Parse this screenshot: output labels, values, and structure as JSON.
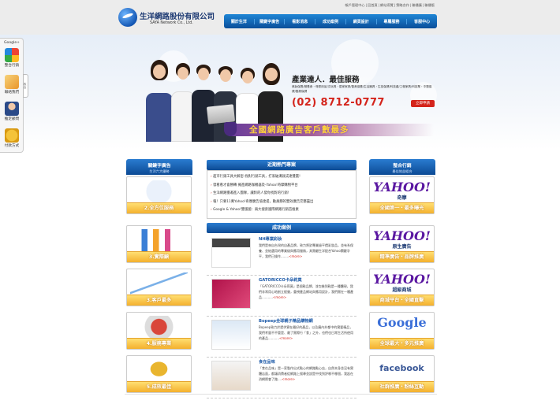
{
  "top_links": [
    "帳戶管理中心",
    "回首頁",
    "網站導覽",
    "策略合作",
    "聯播廣",
    "聯播版"
  ],
  "logo": {
    "cn": "生洋網路股份有限公司",
    "en": "SAYA Network Co., Ltd."
  },
  "nav": [
    "關於生洋",
    "關鍵字廣告",
    "看影消息",
    "成功案例",
    "網頁設計",
    "專屬服務",
    "客服中心"
  ],
  "sidebar": {
    "top": "Google+",
    "items": [
      "整合行銷",
      "聯絡我們",
      "推定顧問",
      "付款方式"
    ],
    "tab": "收合"
  },
  "hero": {
    "title": "產業達人．最佳服務",
    "desc": "美妝保養/營養食・母嬰用品/文玩具・居家家具/醫美保養/生活器具・生技保健/科技產/工程家具/科技業・中醫保健/醫療保健",
    "phone": "(02) 8712-0777",
    "apply": "立即申請",
    "banner": "全國網路廣告客戶數最多"
  },
  "left_col": {
    "title": "關鍵字廣告",
    "subtitle": "生洋六大優勢",
    "tiles": [
      "2.全方位服務",
      "3.實際顧",
      "3.客戶最多",
      "4.服務專業",
      "5.成效最佳"
    ]
  },
  "mid": {
    "hot_title": "近期熱門專案",
    "hot": [
      "超市行銷工具大解密-找對行銷工具，打家破溝就成達雙贏!",
      "發看看才會勝轉 擁進網路咖機器及-Yahoo!奇摩購物平台",
      "生洋網路獲邀進入團隊，讓對的人發你找對的行銷!",
      "報！只要11萬Yahoo!奇摩廣告值達提，動員靜的雙效廣告完整露出",
      "Google & Yahoo!雙版國：兩大搜索國際網路行銷首推素"
    ],
    "cases_title": "成功案例",
    "cases": [
      {
        "title": "NH專業彩妝",
        "desc": "我們是來自台灣的自產品牌，致力將對專業級平價彩妝品，並有系保養、並給選用的專業級與應用服務，其實顧生洋配合Yahoo關鍵字平，我們已操作........",
        "more": "<more>"
      },
      {
        "title": "GATORICCO卡朵莉莫",
        "desc": "「GATORICCO卡朵莉莫」是個鞋品牌，並包裝到鞋是一種體現，我們非常用心地創立經營，重視產品網站與應用設計，我們實在一種產品...........",
        "more": "<more>"
      },
      {
        "title": "Bopeep全球親子精品購物網",
        "desc": "Bopeep致力於提供實在最好的產品，以及廣內外都中的實要精品，我們考量不不管是、最了實際行「食」之外，也們也日常生活所使用的產品...........",
        "more": "<more>"
      },
      {
        "title": "食在品味",
        "desc": "「食在品味」是一家製作出式點心的網路點心店，自然本身並沒有實體店面，都讓消費者從網路上搜尋並說是中找到評哪不哪個，我起在消網際會了路....",
        "more": "<more>"
      }
    ]
  },
  "right_col": {
    "title": "整合行銷",
    "subtitle": "最佳效益組合",
    "tiles": [
      {
        "logo": "YAHOO!",
        "sub": "奇摩",
        "cap": "全國第一・最多曝光"
      },
      {
        "logo": "YAHOO!",
        "sub": "原生廣告",
        "cap": "精準廣告・品牌推廣"
      },
      {
        "logo": "YAHOO!",
        "sub": "超級商城",
        "cap": "商城平台・全國直擊"
      },
      {
        "logo": "Google",
        "sub": "",
        "cap": "全球最大・多元推廣"
      },
      {
        "logo": "facebook",
        "sub": "",
        "cap": "社群推廣・粉絲互動"
      }
    ]
  }
}
